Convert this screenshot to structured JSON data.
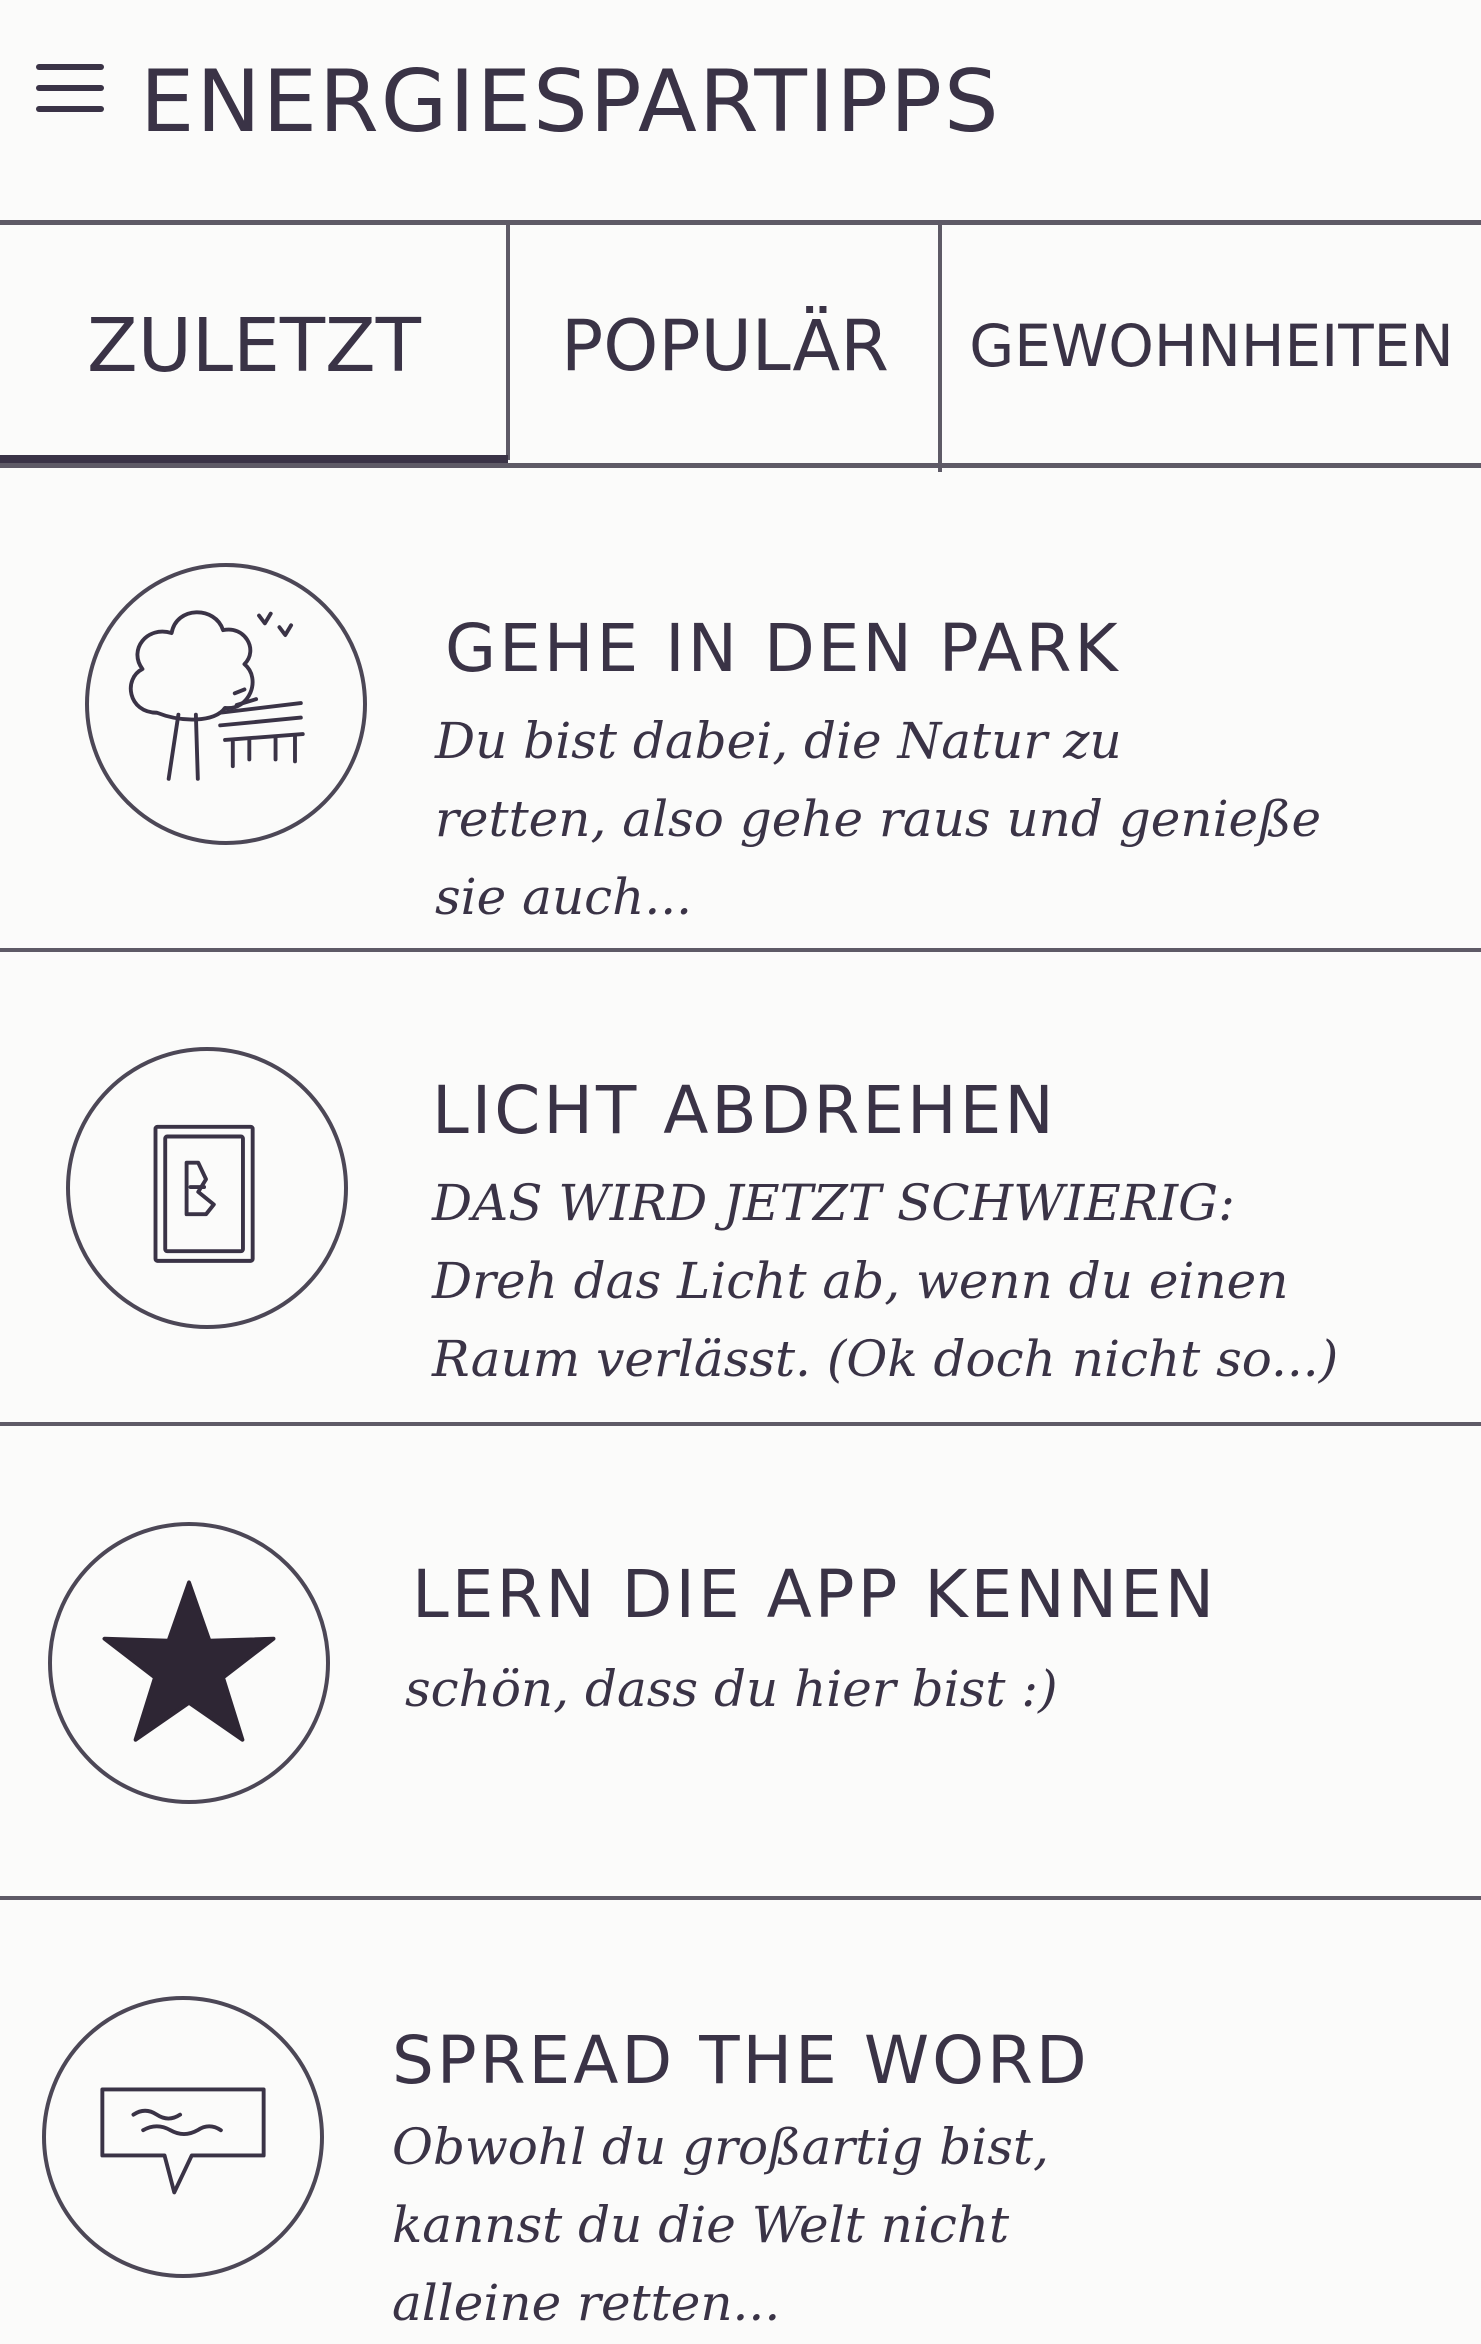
{
  "header": {
    "title": "ENERGIESPARTIPPS"
  },
  "tabs": [
    {
      "label": "ZULETZT"
    },
    {
      "label": "POPULÄR"
    },
    {
      "label": "GEWOHNHEITEN"
    }
  ],
  "tips": [
    {
      "icon": "park-tree-bench-icon",
      "title": "GEHE IN DEN PARK",
      "description": "Du bist dabei, die Natur zu\nretten, also gehe raus und genieße\nsie auch..."
    },
    {
      "icon": "light-switch-icon",
      "title": "LICHT ABDREHEN",
      "description": "DAS WIRD JETZT SCHWIERIG:\nDreh das Licht ab, wenn du einen\nRaum verlässt. (Ok doch nicht so...)"
    },
    {
      "icon": "star-icon",
      "title": "LERN DIE APP KENNEN",
      "description": "schön, dass du hier bist :)"
    },
    {
      "icon": "speech-bubble-icon",
      "title": "SPREAD THE WORD",
      "description": "Obwohl du großartig bist,\nkannst du die Welt nicht\nalleine retten..."
    }
  ]
}
